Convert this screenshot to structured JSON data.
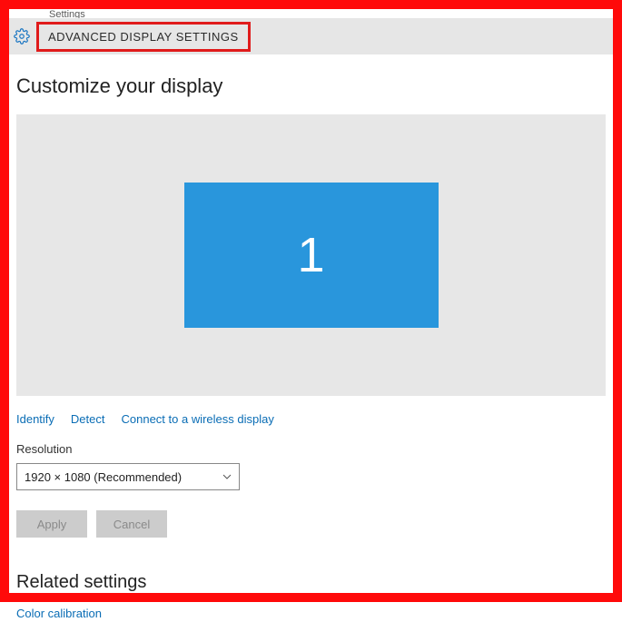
{
  "window": {
    "truncated_text": "Settings"
  },
  "header": {
    "title": "ADVANCED DISPLAY SETTINGS"
  },
  "main": {
    "heading": "Customize your display",
    "monitor_number": "1",
    "links": {
      "identify": "Identify",
      "detect": "Detect",
      "wireless": "Connect to a wireless display"
    },
    "resolution": {
      "label": "Resolution",
      "value": "1920 × 1080 (Recommended)"
    },
    "buttons": {
      "apply": "Apply",
      "cancel": "Cancel"
    },
    "related": {
      "heading": "Related settings",
      "calibration": "Color calibration"
    }
  }
}
